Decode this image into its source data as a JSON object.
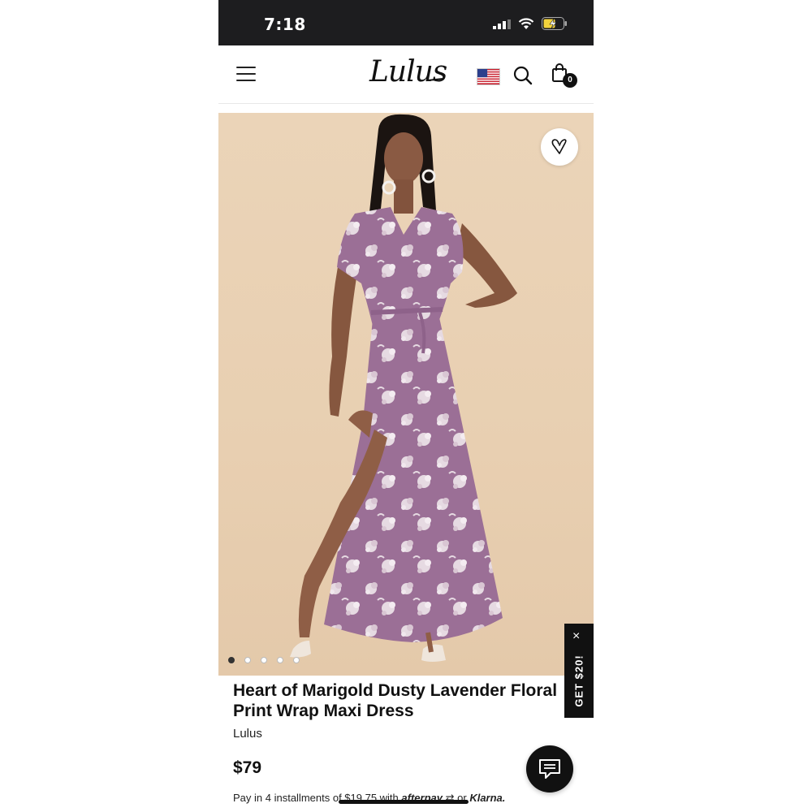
{
  "status_bar": {
    "time": "7:18"
  },
  "header": {
    "logo": "Lulus",
    "cart_count": "0",
    "icons": [
      "menu-icon",
      "us-flag-icon",
      "search-icon",
      "shopping-bag-icon"
    ]
  },
  "gallery": {
    "slide_count": 5,
    "active_slide": 1,
    "background_color": "#e9d1b4",
    "dress_color": "#9b6f96"
  },
  "promo": {
    "label": "GET $20!",
    "close": "×"
  },
  "product": {
    "title": "Heart of Marigold Dusty Lavender Floral Print Wrap Maxi Dress",
    "brand": "Lulus",
    "price": "$79",
    "installments_text": "Pay in 4 installments of $19.75 with",
    "afterpay": "afterpay",
    "or_text": "or",
    "klarna": "Klarna."
  }
}
